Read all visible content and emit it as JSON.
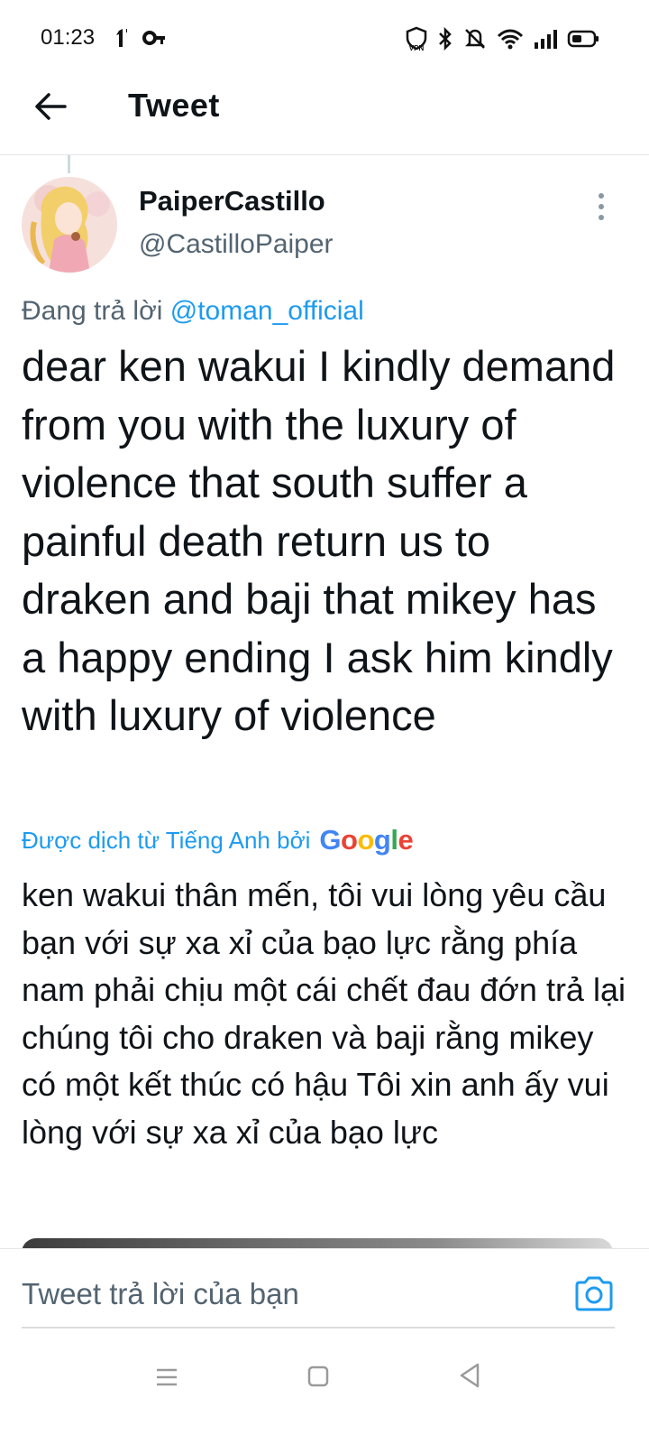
{
  "status_bar": {
    "time": "01:23",
    "left_icons": [
      "network-indicator-icon",
      "key-icon"
    ],
    "right_icons": [
      "vpn-icon",
      "bluetooth-icon",
      "mute-icon",
      "wifi-icon",
      "signal-icon",
      "battery-icon"
    ],
    "vpn_text": "VPN"
  },
  "header": {
    "back_icon": "arrow-left-icon",
    "title": "Tweet"
  },
  "tweet": {
    "author": {
      "display_name": "PaiperCastillo",
      "handle": "@CastilloPaiper"
    },
    "replying_prefix": "Đang trả lời",
    "replying_to": "@toman_official",
    "text": "dear ken wakui I kindly demand from you with the luxury of violence that south suffer a painful death return us to draken and baji that mikey has a happy ending I ask him kindly with luxury of violence",
    "translated_by_label": "Được dịch từ Tiếng Anh bởi",
    "translation_provider": "Google",
    "translation": "ken wakui thân mến, tôi vui lòng yêu cầu bạn với sự xa xỉ của bạo lực rằng phía nam phải chịu một cái chết đau đớn trả lại chúng tôi cho draken và baji rằng mikey có một kết thúc có hậu Tôi xin anh ấy vui lòng với sự xa xỉ của bạo lực"
  },
  "composer": {
    "placeholder": "Tweet trả lời của bạn",
    "camera_icon": "camera-icon"
  },
  "colors": {
    "accent": "#1d9bf0",
    "text_primary": "#0f1419",
    "text_secondary": "#536471"
  },
  "nav": {
    "icons": [
      "menu-icon",
      "home-square-icon",
      "back-triangle-icon"
    ]
  }
}
